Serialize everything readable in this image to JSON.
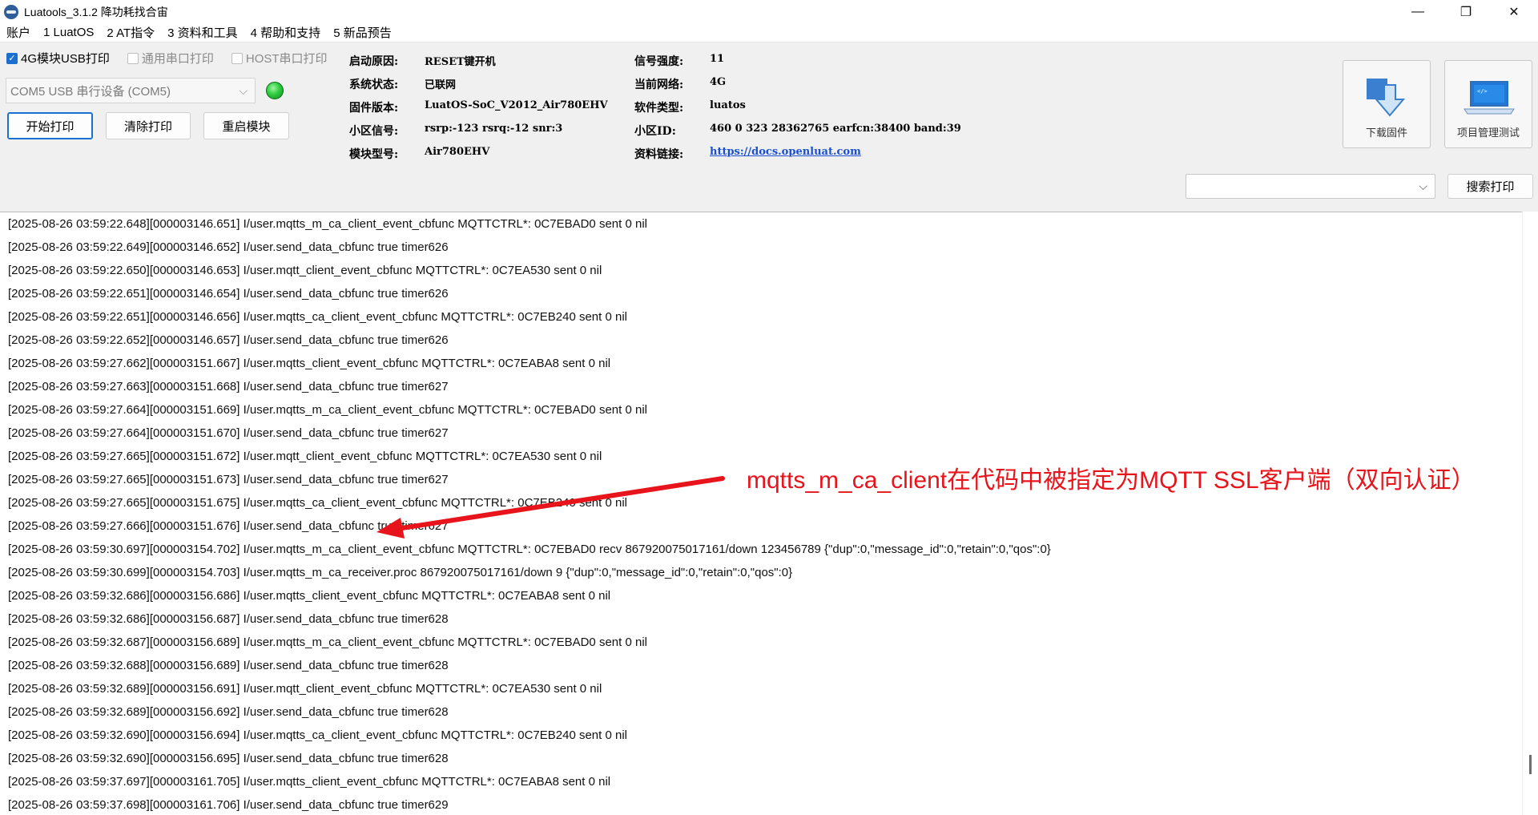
{
  "window": {
    "title": "Luatools_3.1.2 降功耗找合宙",
    "minimize": "—",
    "maximize": "❐",
    "close": "✕"
  },
  "menu": [
    "账户",
    "1 LuatOS",
    "2 AT指令",
    "3 资料和工具",
    "4 帮助和支持",
    "5 新品预告"
  ],
  "checks": {
    "usb4g": "4G模块USB打印",
    "uart": "通用串口打印",
    "host": "HOST串口打印"
  },
  "port": {
    "value": "COM5 USB 串行设备 (COM5)",
    "connected": true
  },
  "buttons": {
    "start": "开始打印",
    "clear": "清除打印",
    "restart": "重启模块",
    "download": "下载固件",
    "project": "项目管理测试",
    "search": "搜索打印"
  },
  "info": {
    "boot_reason_label": "启动原因:",
    "boot_reason": "RESET键开机",
    "sys_state_label": "系统状态:",
    "sys_state": "已联网",
    "firmware_label": "固件版本:",
    "firmware": "LuatOS-SoC_V2012_Air780EHV",
    "cell_signal_label": "小区信号:",
    "cell_signal": "rsrp:-123 rsrq:-12 snr:3",
    "module_label": "模块型号:",
    "module": "Air780EHV",
    "signal_label": "信号强度:",
    "signal": "11",
    "network_label": "当前网络:",
    "network": "4G",
    "software_label": "软件类型:",
    "software": "luatos",
    "cell_id_label": "小区ID:",
    "cell_id": "460 0 323 28362765 earfcn:38400 band:39",
    "docs_label": "资料链接:",
    "docs": "https://docs.openluat.com"
  },
  "log": [
    "[2025-08-26 03:59:22.648][000003146.651] I/user.mqtts_m_ca_client_event_cbfunc MQTTCTRL*: 0C7EBAD0 sent 0 nil",
    "[2025-08-26 03:59:22.649][000003146.652] I/user.send_data_cbfunc true timer626",
    "[2025-08-26 03:59:22.650][000003146.653] I/user.mqtt_client_event_cbfunc MQTTCTRL*: 0C7EA530 sent 0 nil",
    "[2025-08-26 03:59:22.651][000003146.654] I/user.send_data_cbfunc true timer626",
    "[2025-08-26 03:59:22.651][000003146.656] I/user.mqtts_ca_client_event_cbfunc MQTTCTRL*: 0C7EB240 sent 0 nil",
    "[2025-08-26 03:59:22.652][000003146.657] I/user.send_data_cbfunc true timer626",
    "[2025-08-26 03:59:27.662][000003151.667] I/user.mqtts_client_event_cbfunc MQTTCTRL*: 0C7EABA8 sent 0 nil",
    "[2025-08-26 03:59:27.663][000003151.668] I/user.send_data_cbfunc true timer627",
    "[2025-08-26 03:59:27.664][000003151.669] I/user.mqtts_m_ca_client_event_cbfunc MQTTCTRL*: 0C7EBAD0 sent 0 nil",
    "[2025-08-26 03:59:27.664][000003151.670] I/user.send_data_cbfunc true timer627",
    "[2025-08-26 03:59:27.665][000003151.672] I/user.mqtt_client_event_cbfunc MQTTCTRL*: 0C7EA530 sent 0 nil",
    "[2025-08-26 03:59:27.665][000003151.673] I/user.send_data_cbfunc true timer627",
    "[2025-08-26 03:59:27.665][000003151.675] I/user.mqtts_ca_client_event_cbfunc MQTTCTRL*: 0C7EB240 sent 0 nil",
    "[2025-08-26 03:59:27.666][000003151.676] I/user.send_data_cbfunc true timer627",
    "[2025-08-26 03:59:30.697][000003154.702] I/user.mqtts_m_ca_client_event_cbfunc MQTTCTRL*: 0C7EBAD0 recv 867920075017161/down 123456789 {\"dup\":0,\"message_id\":0,\"retain\":0,\"qos\":0}",
    "[2025-08-26 03:59:30.699][000003154.703] I/user.mqtts_m_ca_receiver.proc 867920075017161/down 9 {\"dup\":0,\"message_id\":0,\"retain\":0,\"qos\":0}",
    "[2025-08-26 03:59:32.686][000003156.686] I/user.mqtts_client_event_cbfunc MQTTCTRL*: 0C7EABA8 sent 0 nil",
    "[2025-08-26 03:59:32.686][000003156.687] I/user.send_data_cbfunc true timer628",
    "[2025-08-26 03:59:32.687][000003156.689] I/user.mqtts_m_ca_client_event_cbfunc MQTTCTRL*: 0C7EBAD0 sent 0 nil",
    "[2025-08-26 03:59:32.688][000003156.689] I/user.send_data_cbfunc true timer628",
    "[2025-08-26 03:59:32.689][000003156.691] I/user.mqtt_client_event_cbfunc MQTTCTRL*: 0C7EA530 sent 0 nil",
    "[2025-08-26 03:59:32.689][000003156.692] I/user.send_data_cbfunc true timer628",
    "[2025-08-26 03:59:32.690][000003156.694] I/user.mqtts_ca_client_event_cbfunc MQTTCTRL*: 0C7EB240 sent 0 nil",
    "[2025-08-26 03:59:32.690][000003156.695] I/user.send_data_cbfunc true timer628",
    "[2025-08-26 03:59:37.697][000003161.705] I/user.mqtts_client_event_cbfunc MQTTCTRL*: 0C7EABA8 sent 0 nil",
    "[2025-08-26 03:59:37.698][000003161.706] I/user.send_data_cbfunc true timer629"
  ],
  "annotation": {
    "text": "mqtts_m_ca_client在代码中被指定为MQTT SSL客户端（双向认证）",
    "color": "#e8141c"
  },
  "icons": {
    "download": "download-arrow-icon",
    "project": "laptop-code-icon",
    "dropdown": "chevron-down-icon"
  }
}
